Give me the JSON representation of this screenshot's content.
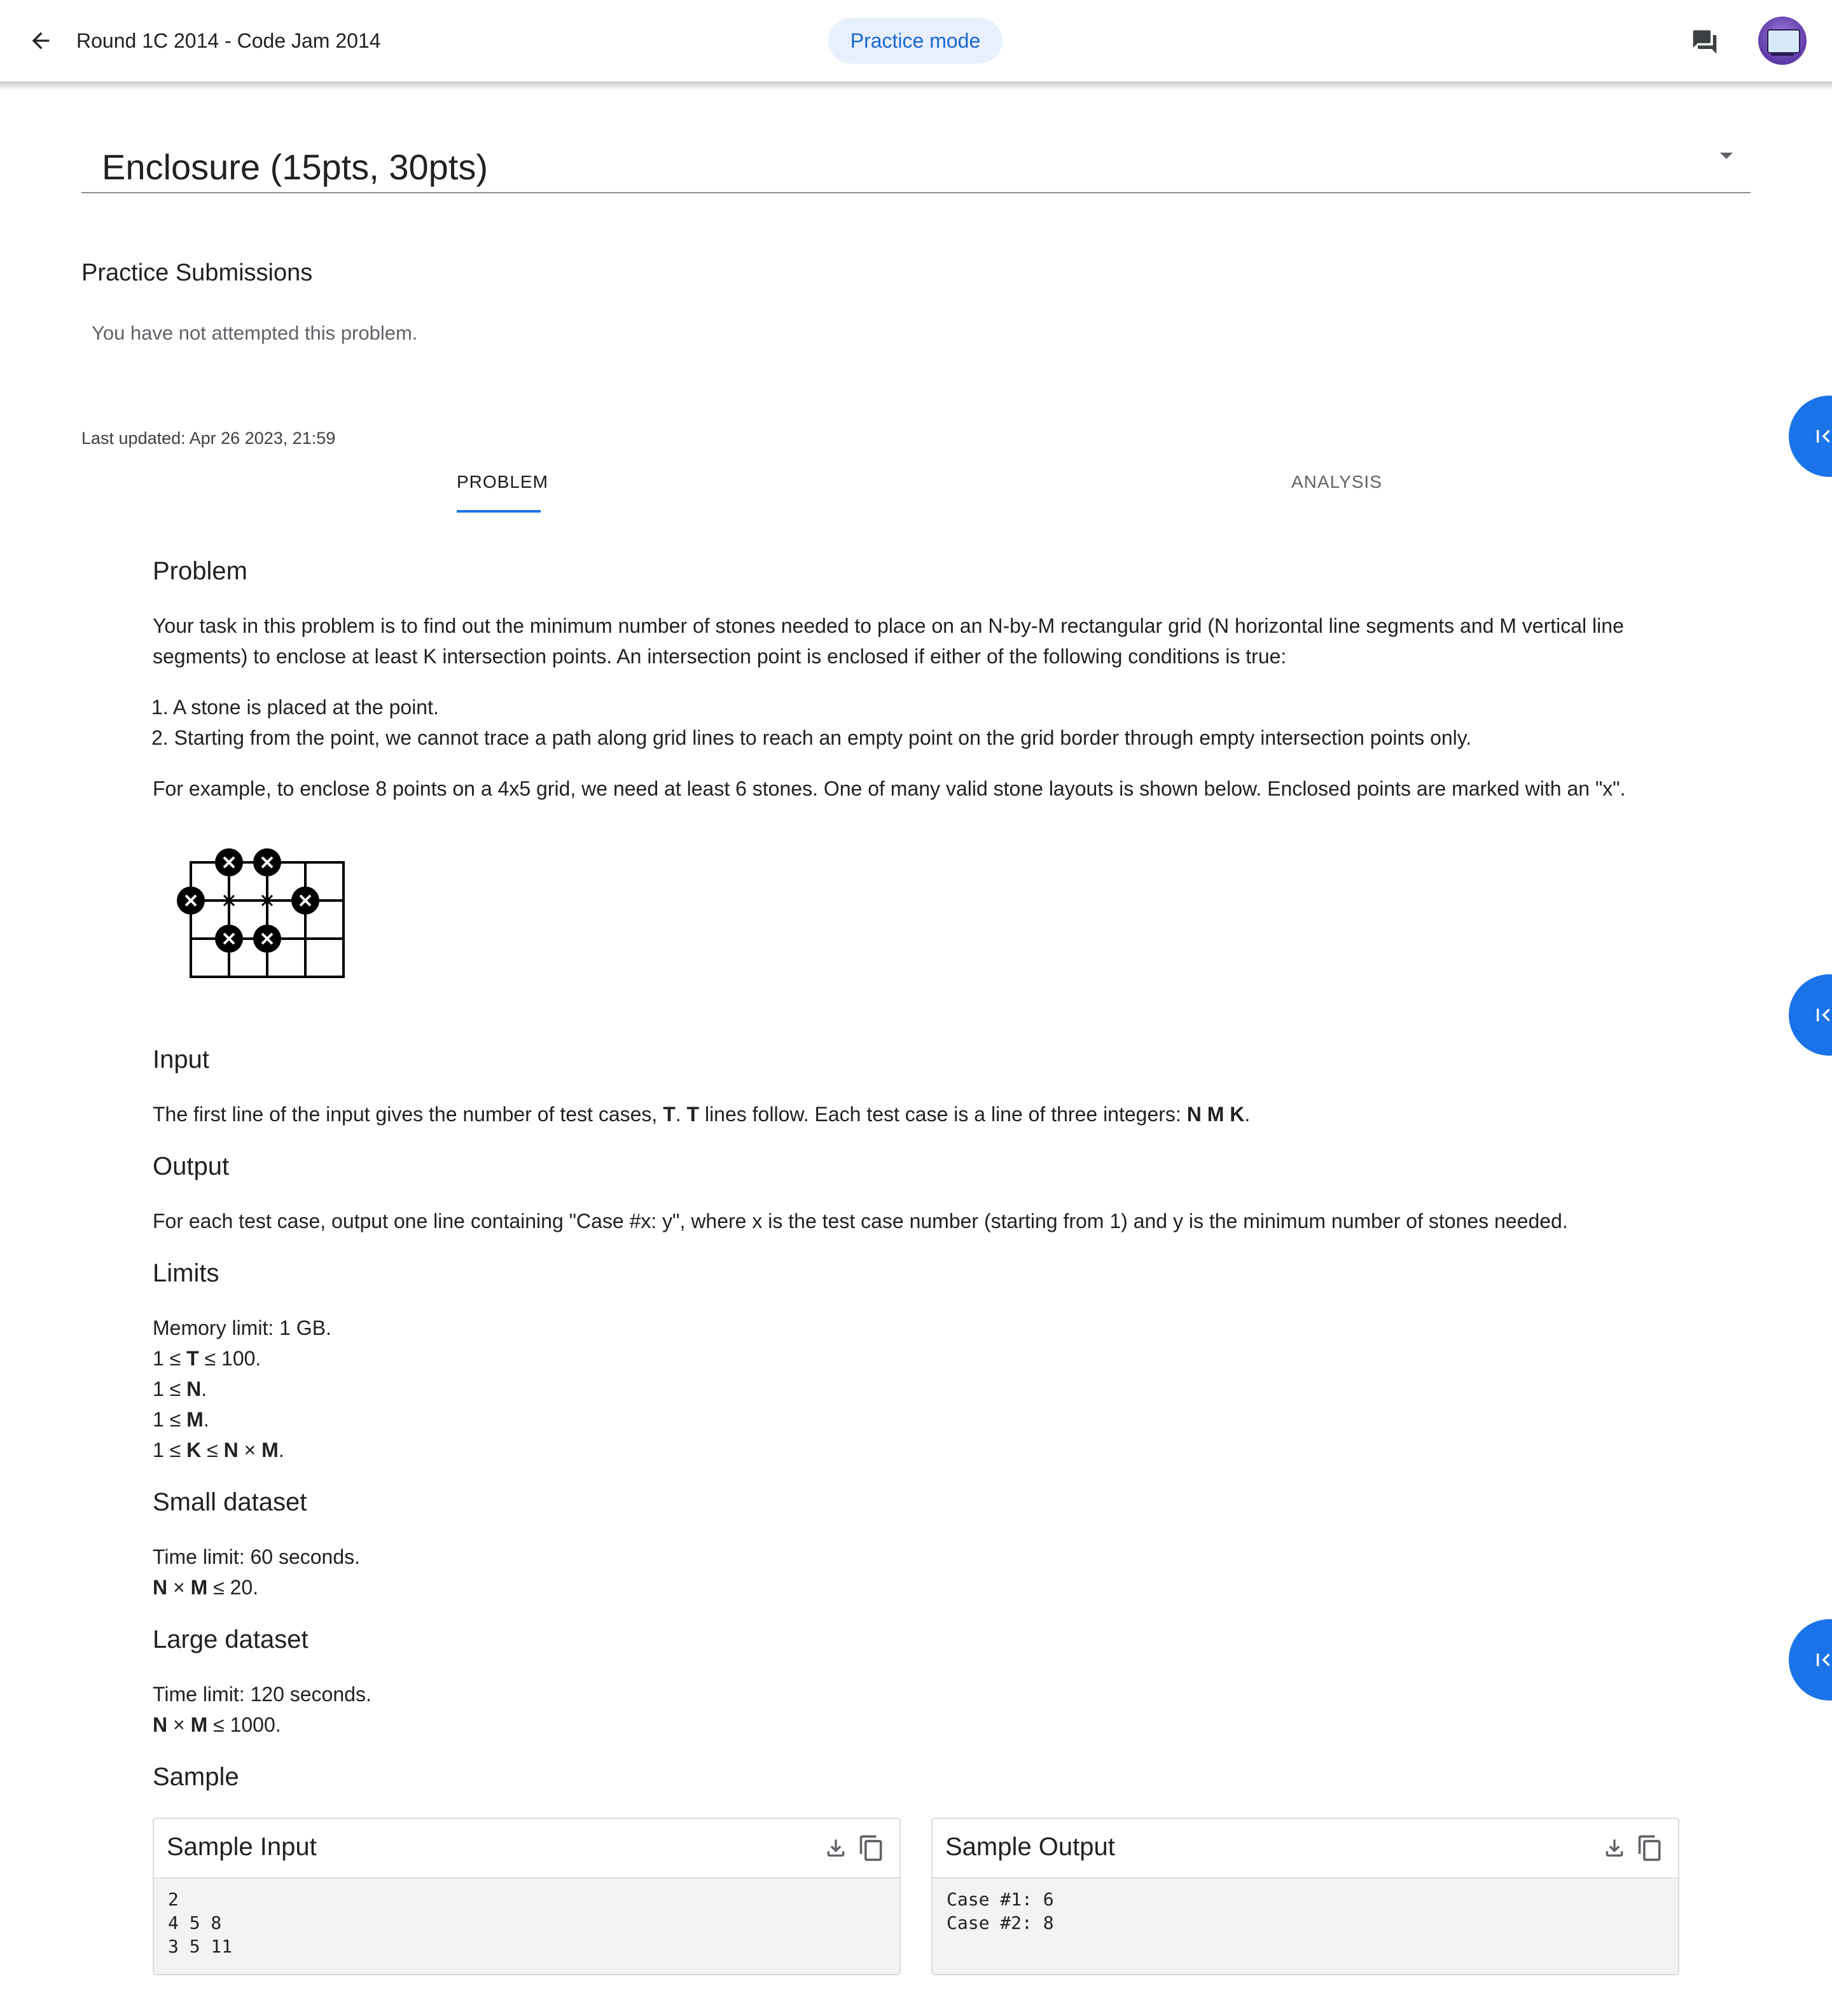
{
  "header": {
    "title": "Round 1C 2014 - Code Jam 2014",
    "mode_label": "Practice mode"
  },
  "problem_select": {
    "value": "Enclosure (15pts, 30pts)"
  },
  "submissions": {
    "heading": "Practice Submissions",
    "empty_text": "You have not attempted this problem."
  },
  "last_updated": "Last updated: Apr 26 2023, 21:59",
  "tabs": [
    {
      "label": "PROBLEM",
      "active": true
    },
    {
      "label": "ANALYSIS",
      "active": false
    }
  ],
  "statement": {
    "problem_heading": "Problem",
    "intro_line1": "Your task in this problem is to find out the minimum number of stones needed to place on an N-by-M rectangular grid (N horizontal line segments and M vertical line",
    "intro_line2": "segments) to enclose at least K intersection points. An intersection point is enclosed if either of the following conditions is true:",
    "conditions": [
      "1. A stone is placed at the point.",
      "2. Starting from the point, we cannot trace a path along grid lines to reach an empty point on the grid border through empty intersection points only."
    ],
    "example_text": "For example, to enclose 8 points on a 4x5 grid, we need at least 6 stones. One of many valid stone layouts is shown below. Enclosed points are marked with an \"x\".",
    "input_heading": "Input",
    "input_pre": "The first line of the input gives the number of test cases, ",
    "input_T": "T",
    "input_mid": ". ",
    "input_T2": "T",
    "input_post": " lines follow. Each test case is a line of three integers: ",
    "input_NMK": "N M K",
    "input_end": ".",
    "output_heading": "Output",
    "output_text": "For each test case, output one line containing \"Case #x: y\", where x is the test case number (starting from 1) and y is the minimum number of stones needed.",
    "limits_heading": "Limits",
    "limits": {
      "memory": "Memory limit: 1 GB.",
      "t_pre": "1 ≤ ",
      "t_var": "T",
      "t_post": " ≤ 100.",
      "n_pre": "1 ≤ ",
      "n_var": "N",
      "n_post": ".",
      "m_pre": "1 ≤ ",
      "m_var": "M",
      "m_post": ".",
      "k_pre": "1 ≤ ",
      "k_var": "K",
      "k_mid": " ≤ ",
      "k_n": "N",
      "k_x": " × ",
      "k_m": "M",
      "k_post": "."
    },
    "small_heading": "Small dataset",
    "small_time": "Time limit: 60 seconds.",
    "small_n": "N",
    "small_x": " × ",
    "small_m": "M",
    "small_post": " ≤ 20.",
    "large_heading": "Large dataset",
    "large_time": "Time limit: 120 seconds.",
    "large_n": "N",
    "large_x": " × ",
    "large_m": "M",
    "large_post": " ≤ 1000.",
    "sample_heading": "Sample"
  },
  "sample_input": {
    "title": "Sample Input",
    "lines": [
      "2",
      "4 5 8",
      "3 5 11"
    ]
  },
  "sample_output": {
    "title": "Sample Output",
    "lines": [
      "Case #1: 6",
      "Case #2: 8"
    ]
  },
  "icons": {
    "back": "arrow-back-icon",
    "chat": "forum-icon",
    "rail": "first-page-icon",
    "download": "download-icon",
    "copy": "copy-icon"
  },
  "colors": {
    "accent": "#1a73e8",
    "chip_bg": "#e8f0fe",
    "chip_text": "#1967d2",
    "sample_body_bg": "#f3f3f3"
  }
}
